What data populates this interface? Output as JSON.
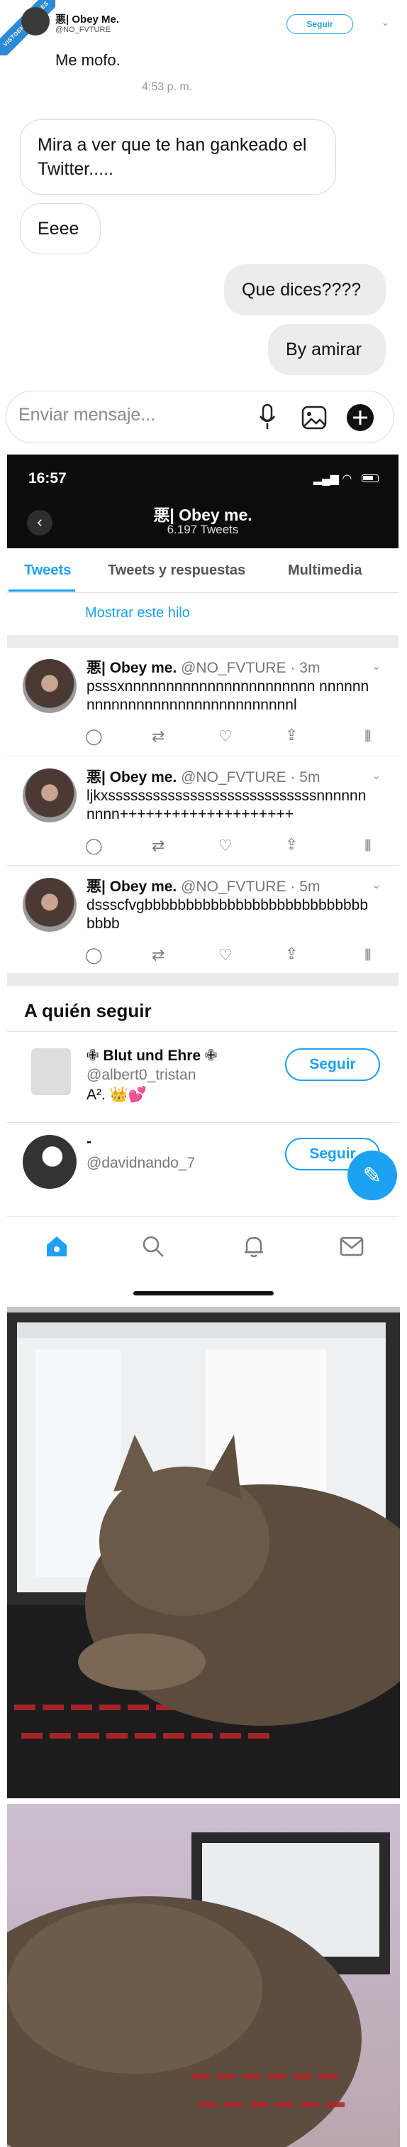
{
  "watermark": {
    "text": "VISTOENLASREDES"
  },
  "header_tweet": {
    "name": "悪| Obey Me.",
    "handle": "@NO_FVTURE",
    "follow_label": "Seguir",
    "message": "Me mofo.",
    "time": "4:53 p. m."
  },
  "chat": {
    "messages": [
      {
        "side": "left",
        "text": "Mira a ver que te han gankeado el Twitter....."
      },
      {
        "side": "left",
        "text": "Eeee"
      },
      {
        "side": "right",
        "text": "Que dices????"
      },
      {
        "side": "right",
        "text": "By amirar"
      }
    ],
    "composer_placeholder": "Enviar mensaje..."
  },
  "phone": {
    "status_time": "16:57",
    "profile_name": "悪| Obey me.",
    "tweet_count": "6.197 Tweets",
    "tabs": [
      {
        "label": "Tweets",
        "active": true
      },
      {
        "label": "Tweets y respuestas",
        "active": false
      },
      {
        "label": "Multimedia",
        "active": false
      }
    ],
    "show_thread": "Mostrar este hilo",
    "tweets": [
      {
        "name": "悪| Obey me.",
        "meta": "@NO_FVTURE · 3m",
        "text": "psssxnnnnnnnnnnnnnnnnnnnnnnn nnnnnnnnnnnnnnnnnnnnnnnnnnnnnnnl"
      },
      {
        "name": "悪| Obey me.",
        "meta": "@NO_FVTURE · 5m",
        "text": "ljkxssssssssssssssssssssssssssssnnnnnnnnnn++++++++++++++++++++"
      },
      {
        "name": "悪| Obey me.",
        "meta": "@NO_FVTURE · 5m",
        "text": "dssscfvgbbbbbbbbbbbbbbbbbbbbbbbbbbbbbbb"
      }
    ],
    "who_to_follow": {
      "title": "A quién seguir",
      "suggestions": [
        {
          "name": "✙ Blut und Ehre ✙",
          "handle": "@albert0_tristan",
          "extra": "A². 👑💕",
          "button": "Seguir"
        },
        {
          "name": "-",
          "handle": "@davidnando_7",
          "button": "Seguir"
        }
      ]
    }
  },
  "icons": [
    "mic-icon",
    "image-icon",
    "add-icon",
    "reply-icon",
    "retweet-icon",
    "like-icon",
    "share-icon",
    "analytics-icon",
    "home-icon",
    "search-icon",
    "bell-icon",
    "mail-icon",
    "compose-icon"
  ],
  "colors": {
    "accent": "#1da1f2",
    "status_bar": "#0c0c0c",
    "bubble_right": "#ececec"
  }
}
